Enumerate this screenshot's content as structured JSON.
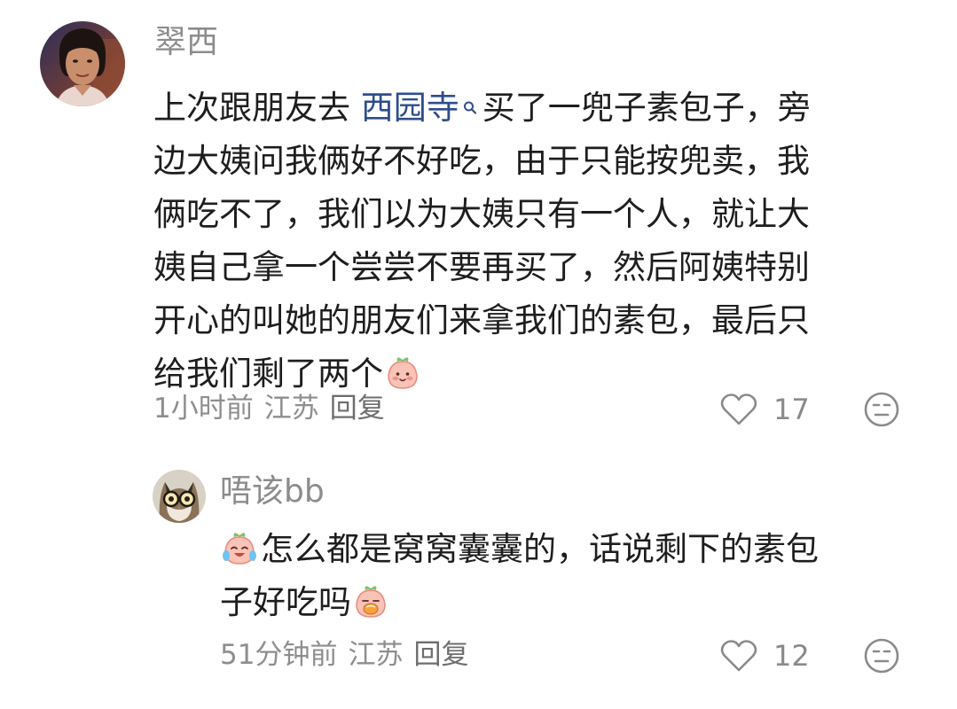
{
  "comments": [
    {
      "username": "翠西",
      "avatar_icon": "avatar-woman-portrait",
      "lines": [
        {
          "pre": "上次跟朋友去 ",
          "link": "西园寺",
          "post": "买了一兜子素包子，旁"
        },
        {
          "text": "边大姨问我俩好不好吃，由于只能按兜卖，我"
        },
        {
          "text": "俩吃不了，我们以为大姨只有一个人，就让大"
        },
        {
          "text": "姨自己拿一个尝尝不要再买了，然后阿姨特别"
        },
        {
          "text": "开心的叫她的朋友们来拿我们的素包，最后只"
        },
        {
          "text": "给我们剩了两个",
          "emoji": "peach-smile-emoji"
        }
      ],
      "meta": {
        "time": "1小时前",
        "location": "江苏",
        "reply": "回复"
      },
      "likes": "17"
    },
    {
      "username": "唔该bb",
      "avatar_icon": "avatar-cat-with-glasses",
      "lines": [
        {
          "lead_emoji": "peach-laugh-cry-emoji",
          "text": "怎么都是窝窝囊囊的，话说剩下的素包"
        },
        {
          "text": "子好吃吗",
          "emoji": "peach-eating-emoji"
        }
      ],
      "meta": {
        "time": "51分钟前",
        "location": "江苏",
        "reply": "回复"
      },
      "likes": "12"
    }
  ],
  "colors": {
    "text": "#1e1e1e",
    "secondary": "#8c8c8c",
    "link": "#2f4d8c",
    "background": "#ffffff"
  }
}
